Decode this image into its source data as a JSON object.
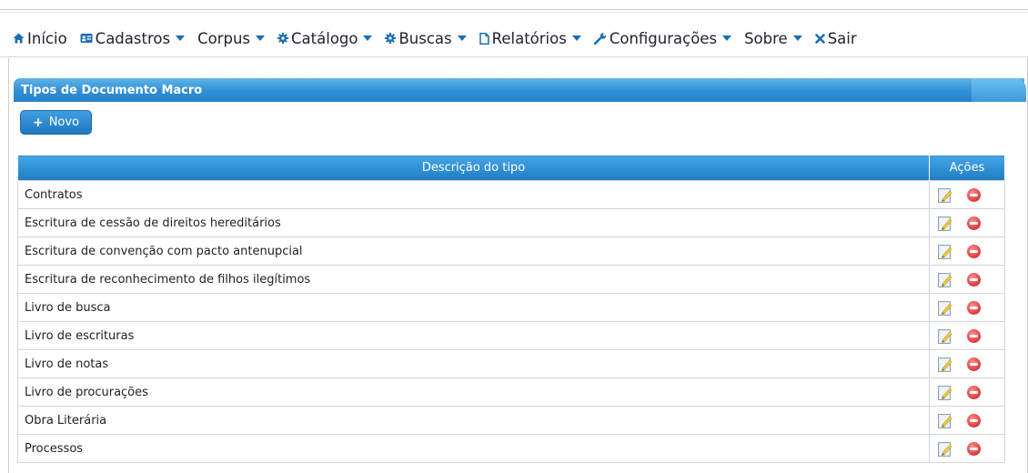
{
  "nav": {
    "items": [
      {
        "label": "Início",
        "icon": "home-icon",
        "caret": false
      },
      {
        "label": "Cadastros",
        "icon": "id-card-icon",
        "caret": true
      },
      {
        "label": "Corpus",
        "icon": "",
        "caret": true
      },
      {
        "label": "Catálogo",
        "icon": "gear-icon",
        "caret": true
      },
      {
        "label": "Buscas",
        "icon": "gear-icon",
        "caret": true
      },
      {
        "label": "Relatórios",
        "icon": "document-icon",
        "caret": true
      },
      {
        "label": "Configurações",
        "icon": "wrench-icon",
        "caret": true
      },
      {
        "label": "Sobre",
        "icon": "",
        "caret": true
      },
      {
        "label": "Sair",
        "icon": "close-icon",
        "caret": false
      }
    ]
  },
  "panel": {
    "title": "Tipos de Documento Macro"
  },
  "toolbar": {
    "new_label": "Novo"
  },
  "table": {
    "headers": {
      "descricao": "Descrição do tipo",
      "acoes": "Ações"
    },
    "rows": [
      "Contratos",
      "Escritura de cessão de direitos hereditários",
      "Escritura de convenção com pacto antenupcial",
      "Escritura de reconhecimento de filhos ilegítimos",
      "Livro de busca",
      "Livro de escrituras",
      "Livro de notas",
      "Livro de procurações",
      "Obra Literária",
      "Processos"
    ]
  },
  "colors": {
    "accent": "#2f8ed6",
    "nav_icon": "#1a6fb0",
    "delete": "#e03c3c"
  }
}
